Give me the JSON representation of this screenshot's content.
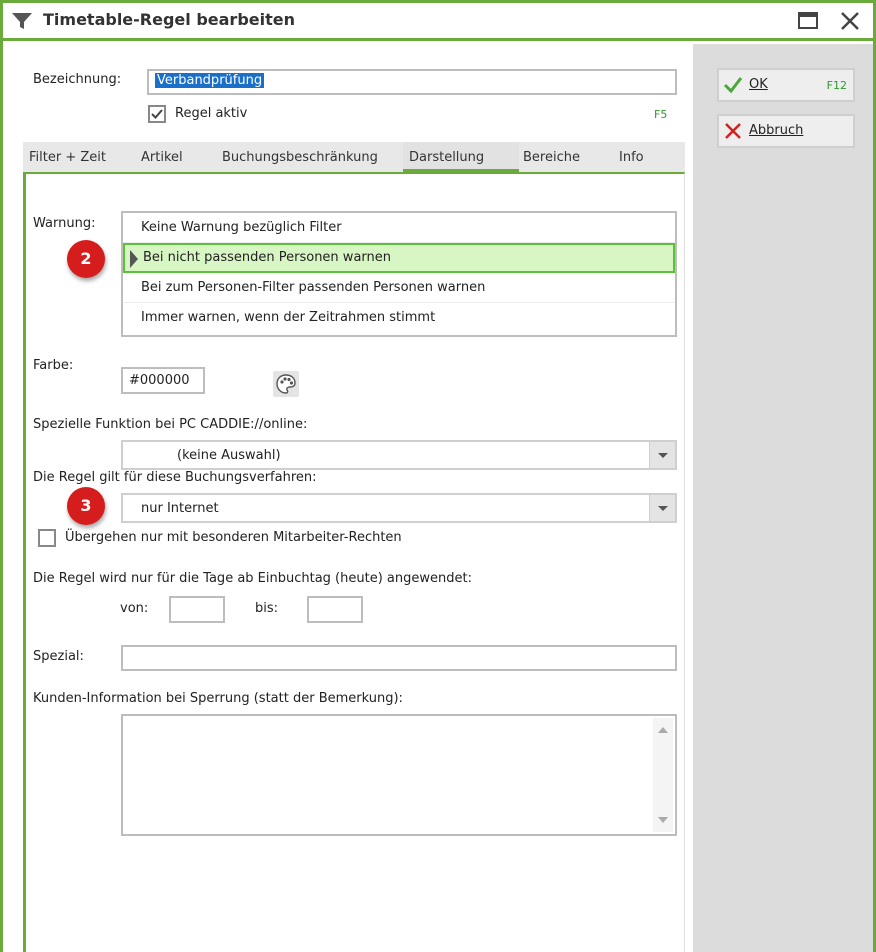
{
  "window": {
    "title": "Timetable-Regel bearbeiten"
  },
  "form": {
    "bezeichnung_label": "Bezeichnung:",
    "bezeichnung_value": "Verbandprüfung",
    "regel_aktiv_label": "Regel aktiv",
    "regel_aktiv_checked": true,
    "f5_hint": "F5"
  },
  "tabs": [
    {
      "label": "Filter + Zeit"
    },
    {
      "label": "Artikel"
    },
    {
      "label": "Buchungsbeschränkung"
    },
    {
      "label": "Darstellung",
      "active": true
    },
    {
      "label": "Bereiche"
    },
    {
      "label": "Info"
    }
  ],
  "darstellung": {
    "warnung_label": "Warnung:",
    "warnung_options": [
      "Keine Warnung bezüglich Filter",
      "Bei nicht passenden Personen warnen",
      "Bei zum Personen-Filter passenden Personen warnen",
      "Immer warnen, wenn der Zeitrahmen stimmt"
    ],
    "warnung_selected_index": 1,
    "farbe_label": "Farbe:",
    "farbe_value": "#000000",
    "spezielle_funktion_label": "Spezielle Funktion bei PC CADDIE://online:",
    "spezielle_funktion_value": "(keine Auswahl)",
    "buchungsverfahren_label": "Die Regel gilt für diese Buchungsverfahren:",
    "buchungsverfahren_value": "nur Internet",
    "uebergehen_label": "Übergehen nur mit besonderen Mitarbeiter-Rechten",
    "uebergehen_checked": false,
    "tage_label": "Die Regel wird nur für die Tage ab Einbuchtag (heute) angewendet:",
    "von_label": "von:",
    "von_value": "",
    "bis_label": "bis:",
    "bis_value": "",
    "spezial_label": "Spezial:",
    "spezial_value": "",
    "kunden_info_label": "Kunden-Information bei Sperrung (statt der Bemerkung):",
    "kunden_info_value": ""
  },
  "badges": [
    "2",
    "3"
  ],
  "side_buttons": {
    "ok_label": "OK",
    "ok_key": "F12",
    "abbruch_label": "Abbruch"
  },
  "colors": {
    "accent_green": "#6aaa3a",
    "selected_row_bg": "#d8f5c4",
    "badge_red": "#d61d1d",
    "selection_blue": "#1a6fc9"
  }
}
